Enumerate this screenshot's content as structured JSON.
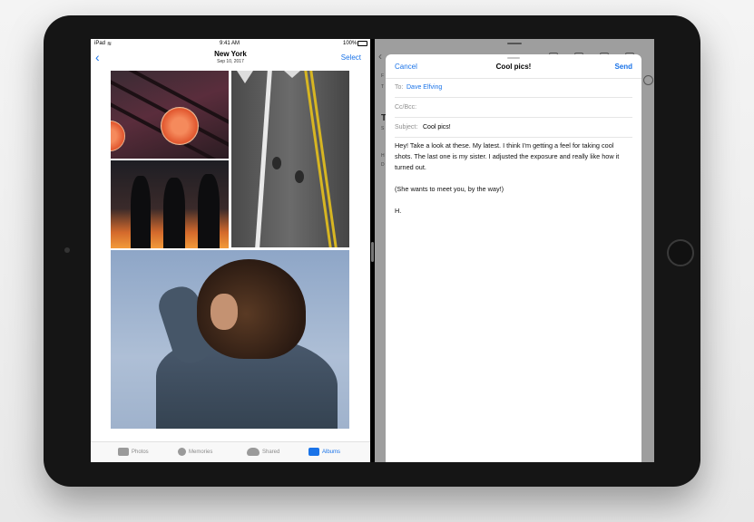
{
  "status_bar": {
    "device": "iPad",
    "time": "9:41 AM",
    "battery": "100%"
  },
  "photos_nav": {
    "title": "New York",
    "date": "Sep 10, 2017",
    "select_label": "Select"
  },
  "tab_bar": {
    "tabs": [
      {
        "label": "Photos",
        "icon": "photos-icon"
      },
      {
        "label": "Memories",
        "icon": "memories-icon"
      },
      {
        "label": "Shared",
        "icon": "shared-cloud-icon"
      },
      {
        "label": "Albums",
        "icon": "albums-icon"
      }
    ],
    "active_tab": "Albums"
  },
  "compose": {
    "cancel_label": "Cancel",
    "title": "Cool pics!",
    "send_label": "Send",
    "to_label": "To:",
    "to_value": "Dave Elfving",
    "cc_label": "Cc/Bcc:",
    "subject_label": "Subject:",
    "subject_value": "Cool pics!",
    "body": [
      "Hey! Take a look at these. My latest. I think I'm getting a feel for taking cool shots. The last one is my sister. I adjusted the exposure and really like how it turned out.",
      "(She wants to meet you, by the way!)",
      "H."
    ]
  },
  "mail_background": {
    "letters": [
      "F",
      "T",
      "T",
      "S",
      "H",
      "D"
    ]
  },
  "colors": {
    "accent": "#1a73e8",
    "bezel": "#151515"
  }
}
